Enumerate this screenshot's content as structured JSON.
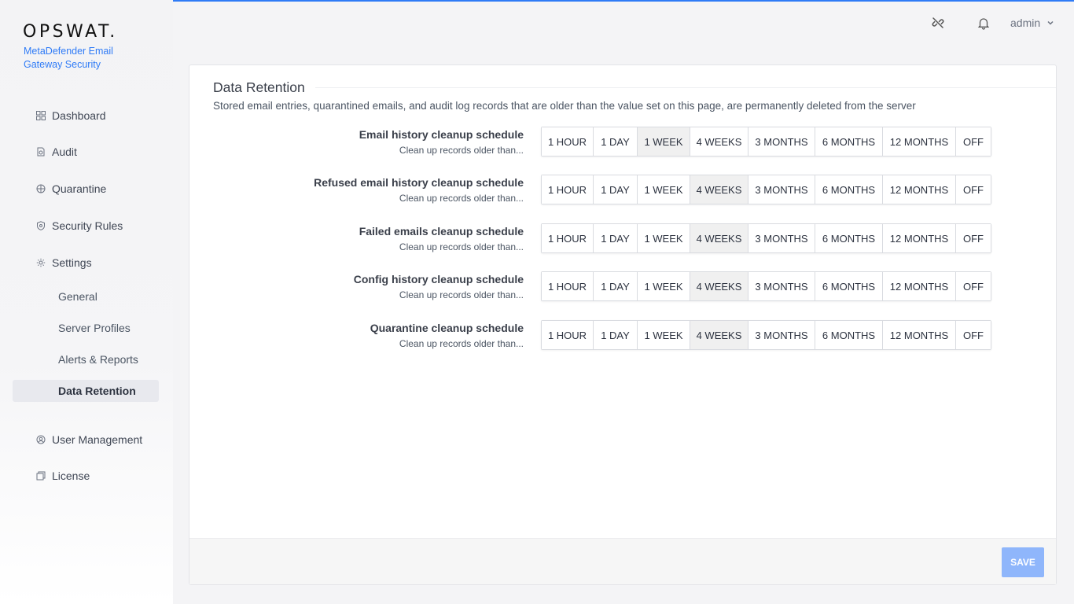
{
  "brand": {
    "logo": "OPSWAT.",
    "product_line1": "MetaDefender Email",
    "product_line2": "Gateway Security"
  },
  "header": {
    "user": "admin",
    "icons": [
      "broken-link-icon",
      "bell-icon",
      "chevron-down-icon"
    ]
  },
  "nav": {
    "dashboard": "Dashboard",
    "audit": "Audit",
    "quarantine": "Quarantine",
    "security_rules": "Security Rules",
    "settings": "Settings",
    "settings_sub": {
      "general": "General",
      "server_profiles": "Server Profiles",
      "alerts_reports": "Alerts & Reports",
      "data_retention": "Data Retention"
    },
    "user_management": "User Management",
    "license": "License"
  },
  "page": {
    "title": "Data Retention",
    "description": "Stored email entries, quarantined emails, and audit log records that are older than the value set on this page, are permanently deleted from the server",
    "options": [
      "1 HOUR",
      "1 DAY",
      "1 WEEK",
      "4 WEEKS",
      "3 MONTHS",
      "6 MONTHS",
      "12 MONTHS",
      "OFF"
    ],
    "rows": [
      {
        "label": "Email history cleanup schedule",
        "sub": "Clean up records older than...",
        "selected": "1 WEEK"
      },
      {
        "label": "Refused email history cleanup schedule",
        "sub": "Clean up records older than...",
        "selected": "4 WEEKS"
      },
      {
        "label": "Failed emails cleanup schedule",
        "sub": "Clean up records older than...",
        "selected": "4 WEEKS"
      },
      {
        "label": "Config history cleanup schedule",
        "sub": "Clean up records older than...",
        "selected": "4 WEEKS"
      },
      {
        "label": "Quarantine cleanup schedule",
        "sub": "Clean up records older than...",
        "selected": "4 WEEKS"
      }
    ],
    "save_label": "SAVE"
  },
  "colors": {
    "accent": "#2f7bf6",
    "save_disabled": "#8fb6fb",
    "selected_segment": "#f0f0f0"
  }
}
